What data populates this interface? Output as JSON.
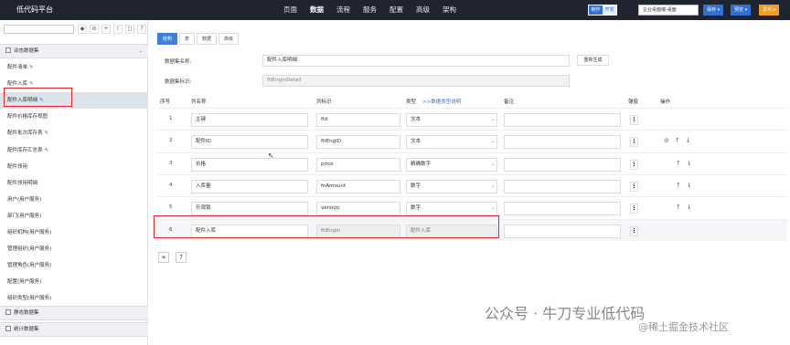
{
  "app": {
    "title": "低代码平台"
  },
  "topnav": [
    "页面",
    "数据",
    "流程",
    "服务",
    "配置",
    "高级",
    "架构"
  ],
  "topnav_active": 1,
  "toggle": {
    "on": "制作",
    "off": "开发"
  },
  "env_value": "企业桌面端-桌面",
  "buttons": {
    "save": "保存 ▾",
    "preview": "预览 ▾",
    "publish": "发布 ▾"
  },
  "colors": {
    "save": "#2f6fd6",
    "preview": "#2f6fd6",
    "publish": "#f0a020",
    "accent": "#3d7fe0",
    "highlight": "#e02a2a"
  },
  "sidebar": {
    "tools": [
      "◆",
      "⊘",
      "+",
      "!",
      "◻",
      "?"
    ],
    "groups": [
      "动态数据集",
      "静态数据集",
      "统计数据集"
    ],
    "items": [
      {
        "label": "配件清单",
        "edit": true
      },
      {
        "label": "配件入库",
        "edit": true
      },
      {
        "label": "配件入库明细",
        "edit": true
      },
      {
        "label": "配件价格库存视图",
        "edit": false
      },
      {
        "label": "配件批次库存表",
        "edit": true
      },
      {
        "label": "配件库存汇总表",
        "edit": true
      },
      {
        "label": "配件领用",
        "edit": false
      },
      {
        "label": "配件领用明细",
        "edit": false
      },
      {
        "label": "用户(用户服务)",
        "edit": false
      },
      {
        "label": "部门(用户服务)",
        "edit": false
      },
      {
        "label": "组织机构(用户服务)",
        "edit": false
      },
      {
        "label": "管理组织(用户服务)",
        "edit": false
      },
      {
        "label": "管理角色(用户服务)",
        "edit": false
      },
      {
        "label": "配置(用户服务)",
        "edit": false
      },
      {
        "label": "组织类型(用户服务)",
        "edit": false
      }
    ]
  },
  "tabs": [
    "结构",
    "表",
    "数据",
    "高级"
  ],
  "form": {
    "name_label": "数据集名称:",
    "name_value": "配件入库明细",
    "regen": "重新生成",
    "id_label": "数据集标识:",
    "id_value": "fitEnginDetail"
  },
  "table": {
    "headers": {
      "seq": "序号",
      "colname": "列名称",
      "colid": "列标识",
      "type": "类型",
      "type_link": ">>数据类型说明",
      "note": "备注",
      "pop": "弹窗",
      "ops": "操作"
    },
    "rows": [
      {
        "seq": "1",
        "name": "主键",
        "id": "fid",
        "type": "文本"
      },
      {
        "seq": "2",
        "name": "配件ID",
        "id": "fitEngID",
        "type": "文本"
      },
      {
        "seq": "3",
        "name": "价格",
        "id": "price",
        "type": "精确数字"
      },
      {
        "seq": "4",
        "name": "入库量",
        "id": "fnAmount",
        "type": "数字"
      },
      {
        "seq": "5",
        "name": "乐观锁",
        "id": "version",
        "type": "数字"
      },
      {
        "seq": "6",
        "name": "配件入库",
        "id": "fitEngIn",
        "type": "配件入库"
      }
    ]
  },
  "bottom_buttons": [
    "+",
    "?"
  ],
  "watermark": "公众号 · 牛刀专业低代码",
  "watermark2": "@稀土掘金技术社区"
}
